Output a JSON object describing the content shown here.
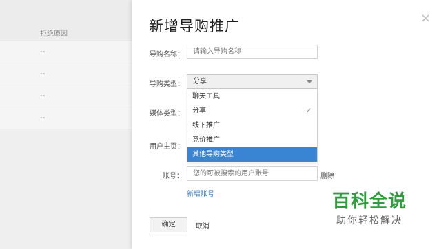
{
  "table": {
    "column_header": "拒绝原因",
    "rows": [
      "--",
      "--",
      "--",
      "--"
    ]
  },
  "drawer": {
    "title": "新增导购推广",
    "close_icon": "×",
    "name_label": "导购名称：",
    "name_placeholder": "请输入导购名称",
    "type_label": "导购类型：",
    "type_value": "分享",
    "media_label": "媒体类型：",
    "homepage_label": "用户主页：",
    "account_label": "账号：",
    "account_placeholder": "您的可被搜索的用户账号",
    "delete_label": "删除",
    "add_account_label": "新增账号",
    "confirm_label": "确定",
    "cancel_label": "取消"
  },
  "dropdown": {
    "options": [
      "聊天工具",
      "分享",
      "线下推广",
      "竞价推广",
      "其他导购类型"
    ],
    "selected": "分享",
    "highlighted": "其他导购类型",
    "check_mark": "✔"
  },
  "watermark": {
    "main": "百科全说",
    "sub": "助你轻松解决"
  },
  "colors": {
    "highlight": "#3a84d4",
    "link": "#2b6fc4",
    "watermark": "#2e9e3c"
  }
}
